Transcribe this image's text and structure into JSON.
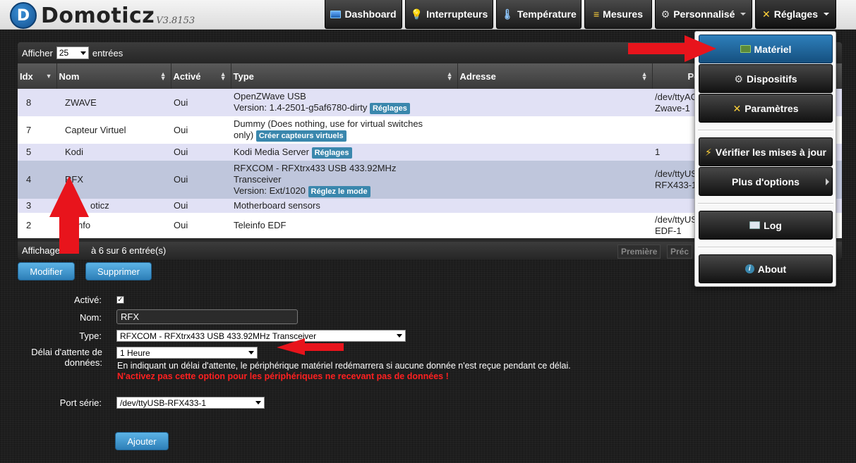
{
  "app": {
    "name": "Domoticz",
    "version": "V3.8153",
    "logo_letter": "D"
  },
  "nav": {
    "items": [
      {
        "label": "Dashboard",
        "icon": "dashboard-icon"
      },
      {
        "label": "Interrupteurs",
        "icon": "lightbulb-icon"
      },
      {
        "label": "Température",
        "icon": "thermometer-icon"
      },
      {
        "label": "Mesures",
        "icon": "measures-icon"
      },
      {
        "label": "Personnalisé",
        "icon": "gear-icon"
      },
      {
        "label": "Réglages",
        "icon": "tools-icon"
      }
    ]
  },
  "table": {
    "show_prefix": "Afficher",
    "page_size": "25",
    "show_suffix": "entrées",
    "columns": [
      "Idx",
      "Nom",
      "Activé",
      "Type",
      "Adresse",
      "Port"
    ],
    "rows": [
      {
        "idx": "8",
        "name": "ZWAVE",
        "enabled": "Oui",
        "type_lines": [
          "OpenZWave USB",
          "Version: 1.4-2501-g5af6780-dirty"
        ],
        "tag": "Réglages",
        "port_lines": [
          "/dev/ttyAC",
          "Zwave-1"
        ]
      },
      {
        "idx": "7",
        "name": "Capteur Virtuel",
        "enabled": "Oui",
        "type_lines": [
          "Dummy (Does nothing, use for virtual switches",
          "only)"
        ],
        "tag": "Créer capteurs virtuels",
        "port_lines": [
          "",
          ""
        ]
      },
      {
        "idx": "5",
        "name": "Kodi",
        "enabled": "Oui",
        "type_lines": [
          "Kodi Media Server"
        ],
        "tag": "Réglages",
        "port_lines": [
          "1",
          ""
        ]
      },
      {
        "idx": "4",
        "name": "RFX",
        "enabled": "Oui",
        "type_lines": [
          "RFXCOM - RFXtrx433 USB 433.92MHz",
          "Transceiver",
          "Version: Ext/1020"
        ],
        "tag": "Réglez le mode",
        "port_lines": [
          "/dev/ttyUS",
          "RFX433-1"
        ]
      },
      {
        "idx": "3",
        "name": "oticz",
        "enabled": "Oui",
        "type_lines": [
          "Motherboard sensors"
        ],
        "tag": "",
        "port_lines": [
          "",
          ""
        ]
      },
      {
        "idx": "2",
        "name": "nfo",
        "enabled": "Oui",
        "type_lines": [
          "Teleinfo EDF"
        ],
        "tag": "",
        "port_lines": [
          "/dev/ttyUS",
          "EDF-1"
        ]
      }
    ],
    "footer_text": "Affichage",
    "footer_text_2": "à 6 sur 6 entrée(s)",
    "pager_first": "Première",
    "pager_prev": "Préc"
  },
  "actions": {
    "modify": "Modifier",
    "delete": "Supprimer"
  },
  "form": {
    "enabled_label": "Activé:",
    "enabled_checked": true,
    "name_label": "Nom:",
    "name_value": "RFX",
    "type_label": "Type:",
    "type_value": "RFXCOM - RFXtrx433 USB 433.92MHz Transceiver",
    "timeout_label_1": "Délai d'attente de",
    "timeout_label_2": "données:",
    "timeout_value": "1 Heure",
    "help_text": "En indiquant un délai d'attente, le périphérique matériel redémarrera si aucune donnée n'est reçue pendant ce délai.",
    "warning_text": "N'activez pas cette option pour les périphériques ne recevant pas de données !",
    "port_label": "Port série:",
    "port_value": "/dev/ttyUSB-RFX433-1",
    "add_button": "Ajouter"
  },
  "menu": {
    "items": [
      {
        "label": "Matériel",
        "icon": "hardware-icon",
        "highlight": true
      },
      {
        "label": "Dispositifs",
        "icon": "gear-icon"
      },
      {
        "label": "Paramètres",
        "icon": "tools-icon"
      },
      {
        "label": "Vérifier les mises à jour",
        "icon": "update-icon"
      },
      {
        "label": "Plus d'options",
        "icon": "",
        "submenu": true
      },
      {
        "label": "Log",
        "icon": "log-icon"
      },
      {
        "label": "About",
        "icon": "info-icon"
      }
    ]
  },
  "colors": {
    "accent_blue": "#3a87ad",
    "annotation_red": "#e8141c",
    "warning_red": "#ff2020"
  }
}
